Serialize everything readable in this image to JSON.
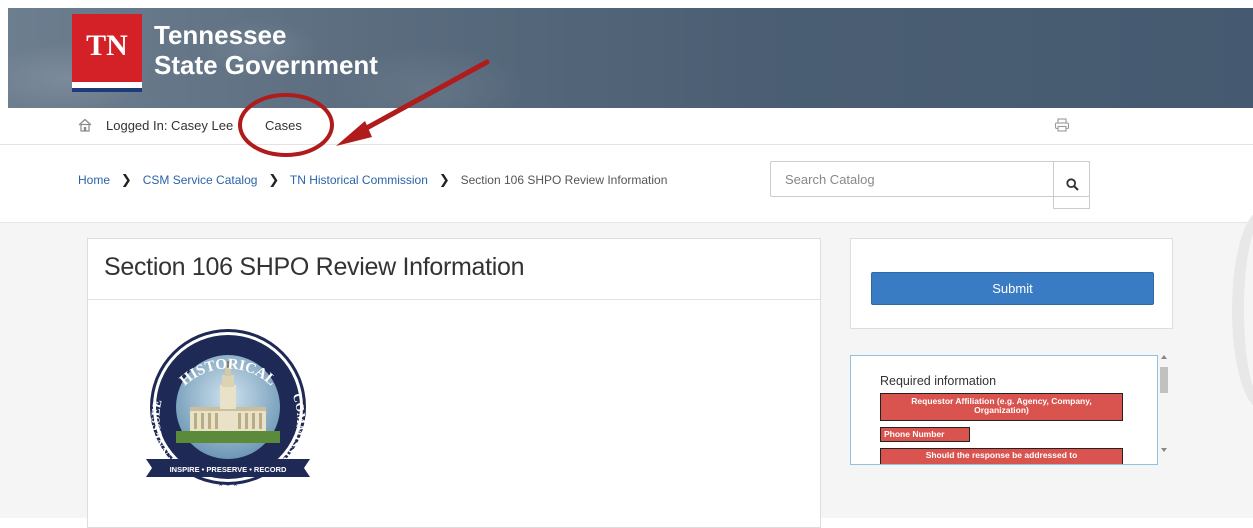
{
  "header": {
    "badge_text": "TN",
    "brand_line1": "Tennessee",
    "brand_line2": "State Government"
  },
  "topnav": {
    "home_icon": "home-icon",
    "logged_in_text": "Logged In: Casey Lee",
    "cases_label": "Cases",
    "print_icon": "print-icon"
  },
  "breadcrumb": {
    "items": [
      "Home",
      "CSM Service Catalog",
      "TN Historical Commission"
    ],
    "current": "Section 106 SHPO Review Information",
    "separator": "❯"
  },
  "search": {
    "placeholder": "Search Catalog",
    "icon": "search-icon"
  },
  "main": {
    "title": "Section 106 SHPO Review Information",
    "seal": {
      "top_text": "HISTORICAL",
      "left_text": "TENNESSEE",
      "right_text": "COMMISSION",
      "ribbon_text": "INSPIRE • PRESERVE • RECORD",
      "stars": "★ ★ ★"
    }
  },
  "sidebar": {
    "submit_label": "Submit",
    "required_title": "Required information",
    "required_items": [
      "Requestor Affiliation (e.g. Agency, Company, Organization)",
      "Phone Number",
      "Should the response be addressed to"
    ]
  },
  "colors": {
    "banner": "#4b5e73",
    "tn_red": "#d42027",
    "link_blue": "#2a63a8",
    "submit_blue": "#3a7cc3",
    "required_red": "#d9534f",
    "annotation_red": "#b01c1c"
  }
}
